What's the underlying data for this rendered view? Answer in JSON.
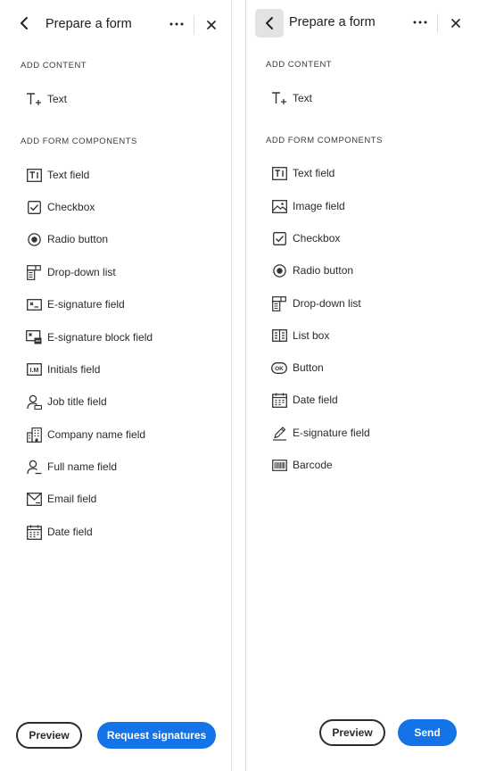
{
  "left_panel": {
    "title": "Prepare a form",
    "section_content": "ADD CONTENT",
    "content_items": [
      {
        "label": "Text",
        "icon": "text-add-icon"
      }
    ],
    "section_components": "ADD FORM COMPONENTS",
    "component_items": [
      {
        "label": "Text field",
        "icon": "text-field-icon"
      },
      {
        "label": "Checkbox",
        "icon": "checkbox-icon"
      },
      {
        "label": "Radio button",
        "icon": "radio-button-icon"
      },
      {
        "label": "Drop-down list",
        "icon": "dropdown-list-icon"
      },
      {
        "label": "E-signature field",
        "icon": "esignature-icon"
      },
      {
        "label": "E-signature block field",
        "icon": "esignature-block-icon"
      },
      {
        "label": "Initials field",
        "icon": "initials-icon"
      },
      {
        "label": "Job title field",
        "icon": "job-title-icon"
      },
      {
        "label": "Company name field",
        "icon": "company-icon"
      },
      {
        "label": "Full name field",
        "icon": "person-icon"
      },
      {
        "label": "Email field",
        "icon": "email-icon"
      },
      {
        "label": "Date field",
        "icon": "calendar-icon"
      }
    ],
    "preview_label": "Preview",
    "primary_label": "Request signatures"
  },
  "right_panel": {
    "title": "Prepare a form",
    "section_content": "ADD CONTENT",
    "content_items": [
      {
        "label": "Text",
        "icon": "text-add-icon"
      }
    ],
    "section_components": "ADD FORM COMPONENTS",
    "component_items": [
      {
        "label": "Text field",
        "icon": "text-field-icon"
      },
      {
        "label": "Image field",
        "icon": "image-icon"
      },
      {
        "label": "Checkbox",
        "icon": "checkbox-icon"
      },
      {
        "label": "Radio button",
        "icon": "radio-button-icon"
      },
      {
        "label": "Drop-down list",
        "icon": "dropdown-list-icon"
      },
      {
        "label": "List box",
        "icon": "list-box-icon"
      },
      {
        "label": "Button",
        "icon": "ok-button-icon"
      },
      {
        "label": "Date field",
        "icon": "calendar-icon"
      },
      {
        "label": "E-signature field",
        "icon": "pen-sign-icon"
      },
      {
        "label": "Barcode",
        "icon": "barcode-icon"
      }
    ],
    "preview_label": "Preview",
    "primary_label": "Send"
  },
  "colors": {
    "accent": "#1473e6",
    "back_button_bg": "#e3e3e3",
    "text": "#2a2a2a"
  }
}
